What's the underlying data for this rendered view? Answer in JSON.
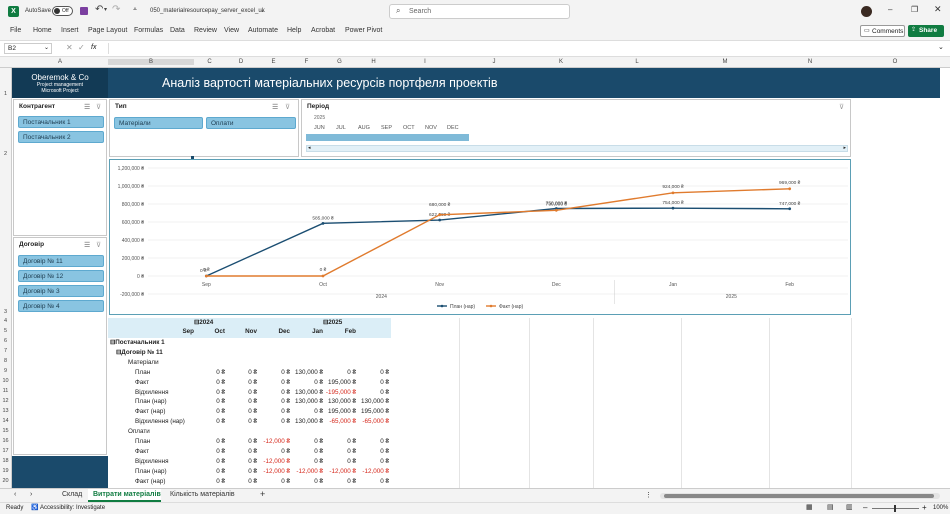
{
  "titlebar": {
    "autosave": "AutoSave",
    "toggle": "Off",
    "filename": "050_materialresourcepay_server_excel_uk",
    "search_placeholder": "Search"
  },
  "menu": [
    "File",
    "Home",
    "Insert",
    "Page Layout",
    "Formulas",
    "Data",
    "Review",
    "View",
    "Automate",
    "Help",
    "Acrobat",
    "Power Pivot"
  ],
  "ribbon_right": {
    "comments": "Comments",
    "share": "Share"
  },
  "formula": {
    "namebox": "B2",
    "fx": "fx",
    "value": ""
  },
  "columns": [
    "A",
    "B",
    "C",
    "D",
    "E",
    "F",
    "G",
    "H",
    "I",
    "J",
    "K",
    "L",
    "M",
    "N",
    "O"
  ],
  "rows": [
    "1",
    "2",
    "3",
    "4",
    "5",
    "6",
    "7",
    "8",
    "9",
    "10",
    "11",
    "12",
    "13",
    "14",
    "15",
    "16",
    "17",
    "18",
    "19",
    "20"
  ],
  "header": {
    "company": "Oberemok & Co",
    "line2": "Project management",
    "line3": "Microsoft Project",
    "title": "Аналіз вартості матеріальних ресурсів портфеля проектів"
  },
  "slicers": {
    "contractor": {
      "title": "Контрагент",
      "items": [
        "Постачальник 1",
        "Постачальник 2"
      ]
    },
    "type": {
      "title": "Тип",
      "items": [
        "Матеріали",
        "Оплати"
      ]
    },
    "period": {
      "title": "Період",
      "year": "2025",
      "months": [
        "JUN",
        "JUL",
        "AUG",
        "SEP",
        "OCT",
        "NOV",
        "DEC"
      ]
    },
    "contract": {
      "title": "Договір",
      "items": [
        "Договір № 11",
        "Договір № 12",
        "Договір № 3",
        "Договір № 4"
      ]
    }
  },
  "chart_data": {
    "type": "line",
    "categories": [
      "Sep",
      "Oct",
      "Nov",
      "Dec",
      "Jan",
      "Feb"
    ],
    "year_labels": [
      "2024",
      "2025"
    ],
    "ylim": [
      -200000,
      1200000
    ],
    "yticks": [
      "1,200,000 ₴",
      "1,000,000 ₴",
      "800,000 ₴",
      "600,000 ₴",
      "400,000 ₴",
      "200,000 ₴",
      "0 ₴",
      "-200,000 ₴"
    ],
    "series": [
      {
        "name": "План (нар)",
        "color": "#1b4e72",
        "values": [
          0,
          585000,
          622000,
          750000,
          754000,
          747000
        ],
        "labels": [
          "0 ₴",
          "585,000 ₴",
          "622,000 ₴",
          "750,000 ₴",
          "754,000 ₴",
          "747,000 ₴"
        ]
      },
      {
        "name": "Факт (нар)",
        "color": "#e07b2e",
        "values": [
          0,
          0,
          680000,
          730000,
          924000,
          969000
        ],
        "labels": [
          "0 ₴",
          "0 ₴",
          "680,000 ₴",
          "730,000 ₴",
          "924,000 ₴",
          "969,000 ₴"
        ]
      }
    ]
  },
  "pivot": {
    "years": [
      "2024",
      "2025"
    ],
    "months": [
      "Sep",
      "Oct",
      "Nov",
      "Dec",
      "Jan",
      "Feb"
    ],
    "rows": [
      {
        "label": "Постачальник 1",
        "level": 0,
        "bold": true,
        "values": []
      },
      {
        "label": "Договір № 11",
        "level": 1,
        "bold": true,
        "values": []
      },
      {
        "label": "Матеріали",
        "level": 2,
        "bold": false,
        "values": []
      },
      {
        "label": "План",
        "level": 3,
        "values": [
          "0 ₴",
          "0 ₴",
          "0 ₴",
          "130,000 ₴",
          "0 ₴",
          "0 ₴"
        ]
      },
      {
        "label": "Факт",
        "level": 3,
        "values": [
          "0 ₴",
          "0 ₴",
          "0 ₴",
          "0 ₴",
          "195,000 ₴",
          "0 ₴"
        ]
      },
      {
        "label": "Відхилення",
        "level": 3,
        "values": [
          "0 ₴",
          "0 ₴",
          "0 ₴",
          "130,000 ₴",
          "-195,000 ₴",
          "0 ₴"
        ]
      },
      {
        "label": "План (нар)",
        "level": 3,
        "values": [
          "0 ₴",
          "0 ₴",
          "0 ₴",
          "130,000 ₴",
          "130,000 ₴",
          "130,000 ₴"
        ]
      },
      {
        "label": "Факт (нар)",
        "level": 3,
        "values": [
          "0 ₴",
          "0 ₴",
          "0 ₴",
          "0 ₴",
          "195,000 ₴",
          "195,000 ₴"
        ]
      },
      {
        "label": "Відхилення (нар)",
        "level": 3,
        "values": [
          "0 ₴",
          "0 ₴",
          "0 ₴",
          "130,000 ₴",
          "-65,000 ₴",
          "-65,000 ₴"
        ]
      },
      {
        "label": "Оплати",
        "level": 2,
        "values": []
      },
      {
        "label": "План",
        "level": 3,
        "values": [
          "0 ₴",
          "0 ₴",
          "-12,000 ₴",
          "0 ₴",
          "0 ₴",
          "0 ₴"
        ]
      },
      {
        "label": "Факт",
        "level": 3,
        "values": [
          "0 ₴",
          "0 ₴",
          "0 ₴",
          "0 ₴",
          "0 ₴",
          "0 ₴"
        ]
      },
      {
        "label": "Відхилення",
        "level": 3,
        "values": [
          "0 ₴",
          "0 ₴",
          "-12,000 ₴",
          "0 ₴",
          "0 ₴",
          "0 ₴"
        ]
      },
      {
        "label": "План (нар)",
        "level": 3,
        "values": [
          "0 ₴",
          "0 ₴",
          "-12,000 ₴",
          "-12,000 ₴",
          "-12,000 ₴",
          "-12,000 ₴"
        ]
      },
      {
        "label": "Факт (нар)",
        "level": 3,
        "values": [
          "0 ₴",
          "0 ₴",
          "0 ₴",
          "0 ₴",
          "0 ₴",
          "0 ₴"
        ]
      }
    ]
  },
  "sheets": [
    "Склад",
    "Витрати матеріалів",
    "Кількість матеріалів"
  ],
  "active_sheet": 1,
  "status": {
    "ready": "Ready",
    "accessibility": "Accessibility: Investigate",
    "zoom": "100%"
  },
  "colors": {
    "brand": "#1a4a6b",
    "slicer": "#89c4e1",
    "excel_green": "#107c41"
  }
}
